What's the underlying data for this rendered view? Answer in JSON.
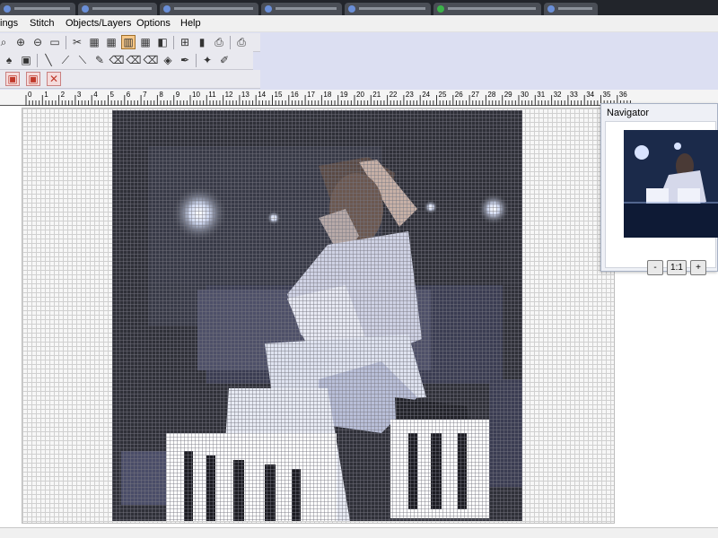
{
  "menu": {
    "items": [
      {
        "label": "ings"
      },
      {
        "label": "Stitch"
      },
      {
        "label": "Objects/Layers"
      },
      {
        "label": "Options"
      },
      {
        "label": "Help"
      }
    ]
  },
  "toolbar": {
    "row1_icons": [
      "zoom-out-icon",
      "zoom-in-icon",
      "zoom-minus-icon",
      "zoom-fit-icon",
      "cut-icon",
      "grid-off-icon",
      "grid-icon",
      "grid-large-icon",
      "grid-major-icon",
      "layers-icon",
      "resize-icon",
      "book-icon",
      "print-preview-icon",
      "print-icon"
    ],
    "row1_glyphs": [
      "⌕",
      "⊕",
      "⊖",
      "▭",
      "✂",
      "▦",
      "▦",
      "▥",
      "▦",
      "◧",
      "⊞",
      "▮",
      "⎙",
      "⎙"
    ],
    "row2_icons": [
      "fill-icon",
      "stamp-icon",
      "backstitch-icon",
      "zigzag-icon",
      "stepline-icon",
      "pencil-icon",
      "eraser-icon",
      "eraser-alt-icon",
      "eraser-line-icon",
      "select-icon",
      "eyedropper-icon",
      "sparkle-icon",
      "magic-pen-icon"
    ],
    "row2_glyphs": [
      "♠",
      "▣",
      "╲",
      "⟋",
      "⟍",
      "✎",
      "⌫",
      "⌫",
      "⌫",
      "◈",
      "✒",
      "✦",
      "✐"
    ],
    "row3_icons": [
      "layer-up-icon",
      "layer-down-icon",
      "close-layer-icon"
    ],
    "row3_glyphs": [
      "▣",
      "▣",
      "✕"
    ]
  },
  "ruler": {
    "labels": [
      "0",
      "1",
      "2",
      "3",
      "4",
      "5",
      "6",
      "7",
      "8",
      "9",
      "10",
      "11",
      "12",
      "13",
      "14",
      "15",
      "16",
      "17",
      "18",
      "19",
      "20",
      "21",
      "22",
      "23",
      "24",
      "25",
      "26",
      "27",
      "28",
      "29",
      "30",
      "31",
      "32",
      "33",
      "34",
      "35",
      "36"
    ]
  },
  "navigator": {
    "title": "Navigator",
    "zoom_out_label": "-",
    "zoom_reset_label": "1:1",
    "zoom_in_label": "+"
  },
  "colors": {
    "accent_pressed": "#f6c889",
    "toolbar_bg": "#dcdff2",
    "pattern_bg": "#2f3038",
    "stage_light": "#cfd8f0"
  }
}
